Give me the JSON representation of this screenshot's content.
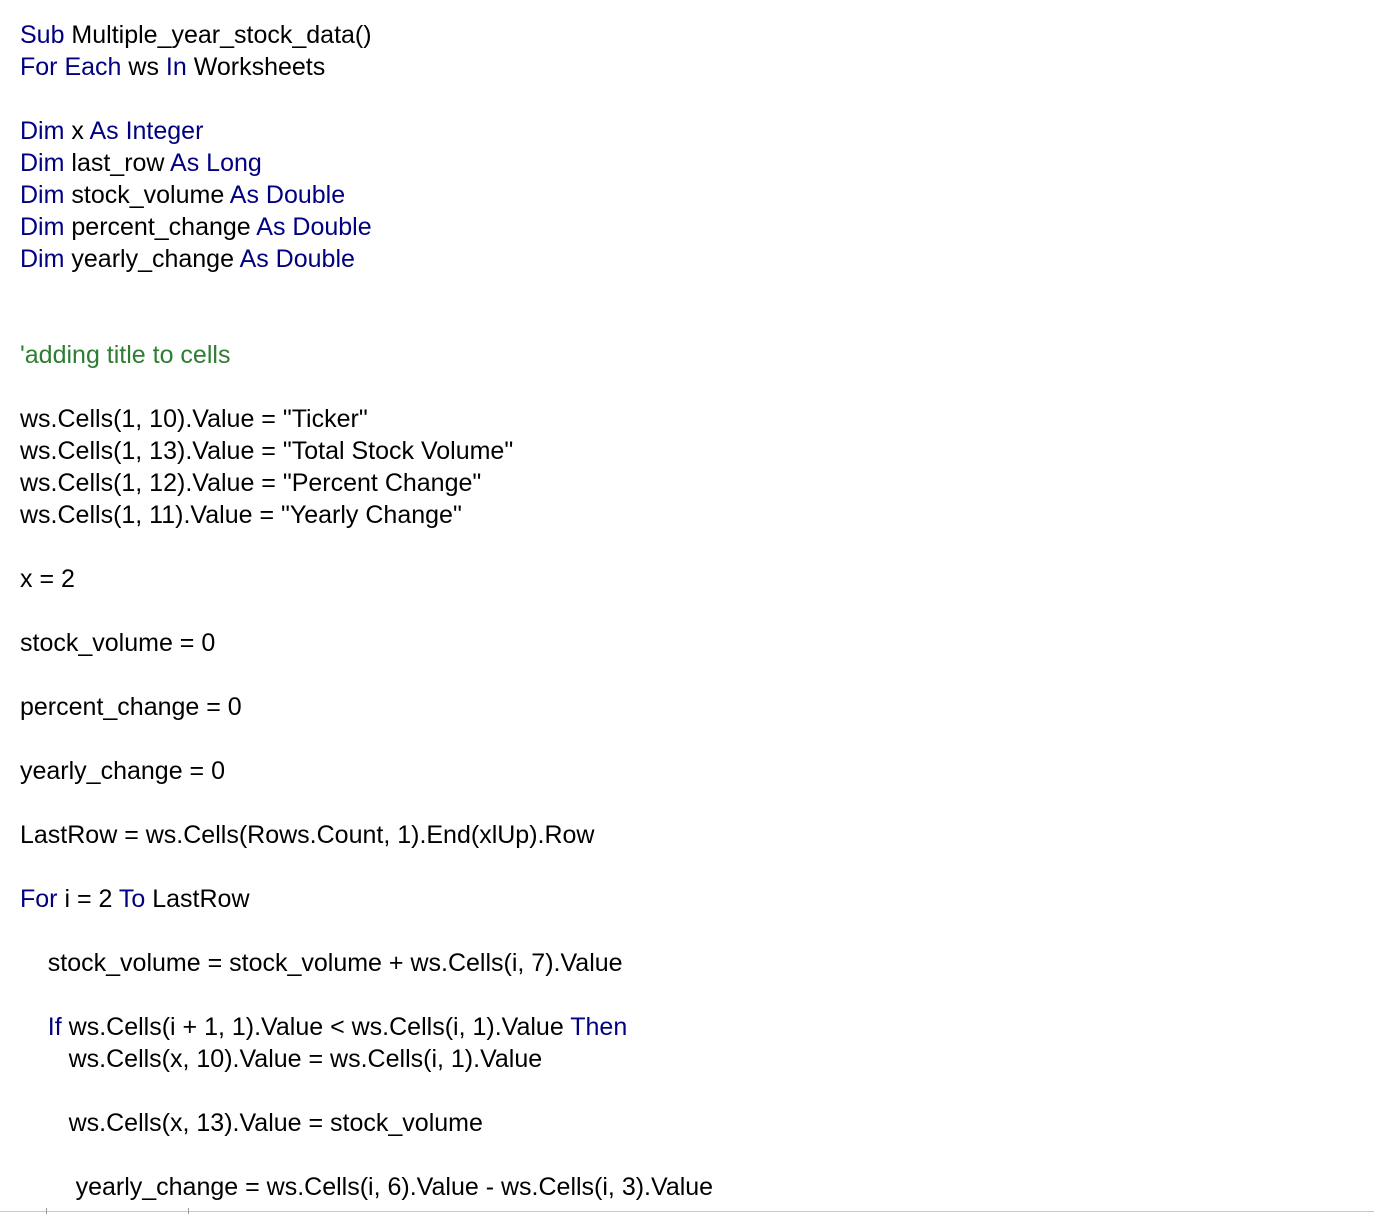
{
  "editor": {
    "colors": {
      "keyword": "#000080",
      "comment": "#2e7d32",
      "text": "#000000",
      "background": "#ffffff"
    },
    "lines": [
      [
        {
          "t": "Sub",
          "k": true
        },
        {
          "t": " Multiple_year_stock_data()"
        }
      ],
      [
        {
          "t": "For Each",
          "k": true
        },
        {
          "t": " ws "
        },
        {
          "t": "In",
          "k": true
        },
        {
          "t": " Worksheets"
        }
      ],
      [],
      [
        {
          "t": "Dim",
          "k": true
        },
        {
          "t": " x "
        },
        {
          "t": "As Integer",
          "k": true
        }
      ],
      [
        {
          "t": "Dim",
          "k": true
        },
        {
          "t": " last_row "
        },
        {
          "t": "As Long",
          "k": true
        }
      ],
      [
        {
          "t": "Dim",
          "k": true
        },
        {
          "t": " stock_volume "
        },
        {
          "t": "As Double",
          "k": true
        }
      ],
      [
        {
          "t": "Dim",
          "k": true
        },
        {
          "t": " percent_change "
        },
        {
          "t": "As Double",
          "k": true
        }
      ],
      [
        {
          "t": "Dim",
          "k": true
        },
        {
          "t": " yearly_change "
        },
        {
          "t": "As Double",
          "k": true
        }
      ],
      [],
      [],
      [
        {
          "t": "'adding title to cells",
          "c": true
        }
      ],
      [],
      [
        {
          "t": "ws.Cells(1, 10).Value = \"Ticker\""
        }
      ],
      [
        {
          "t": "ws.Cells(1, 13).Value = \"Total Stock Volume\""
        }
      ],
      [
        {
          "t": "ws.Cells(1, 12).Value = \"Percent Change\""
        }
      ],
      [
        {
          "t": "ws.Cells(1, 11).Value = \"Yearly Change\""
        }
      ],
      [],
      [
        {
          "t": "x = 2"
        }
      ],
      [],
      [
        {
          "t": "stock_volume = 0"
        }
      ],
      [],
      [
        {
          "t": "percent_change = 0"
        }
      ],
      [],
      [
        {
          "t": "yearly_change = 0"
        }
      ],
      [],
      [
        {
          "t": "LastRow = ws.Cells(Rows.Count, 1).End(xlUp).Row"
        }
      ],
      [],
      [
        {
          "t": "For",
          "k": true
        },
        {
          "t": " i = 2 "
        },
        {
          "t": "To",
          "k": true
        },
        {
          "t": " LastRow"
        }
      ],
      [],
      [
        {
          "t": "    stock_volume = stock_volume + ws.Cells(i, 7).Value"
        }
      ],
      [],
      [
        {
          "t": "    "
        },
        {
          "t": "If",
          "k": true
        },
        {
          "t": " ws.Cells(i + 1, 1).Value < ws.Cells(i, 1).Value "
        },
        {
          "t": "Then",
          "k": true
        }
      ],
      [
        {
          "t": "       ws.Cells(x, 10).Value = ws.Cells(i, 1).Value"
        }
      ],
      [],
      [
        {
          "t": "       ws.Cells(x, 13).Value = stock_volume"
        }
      ],
      [],
      [
        {
          "t": "        yearly_change = ws.Cells(i, 6).Value - ws.Cells(i, 3).Value"
        }
      ]
    ]
  }
}
